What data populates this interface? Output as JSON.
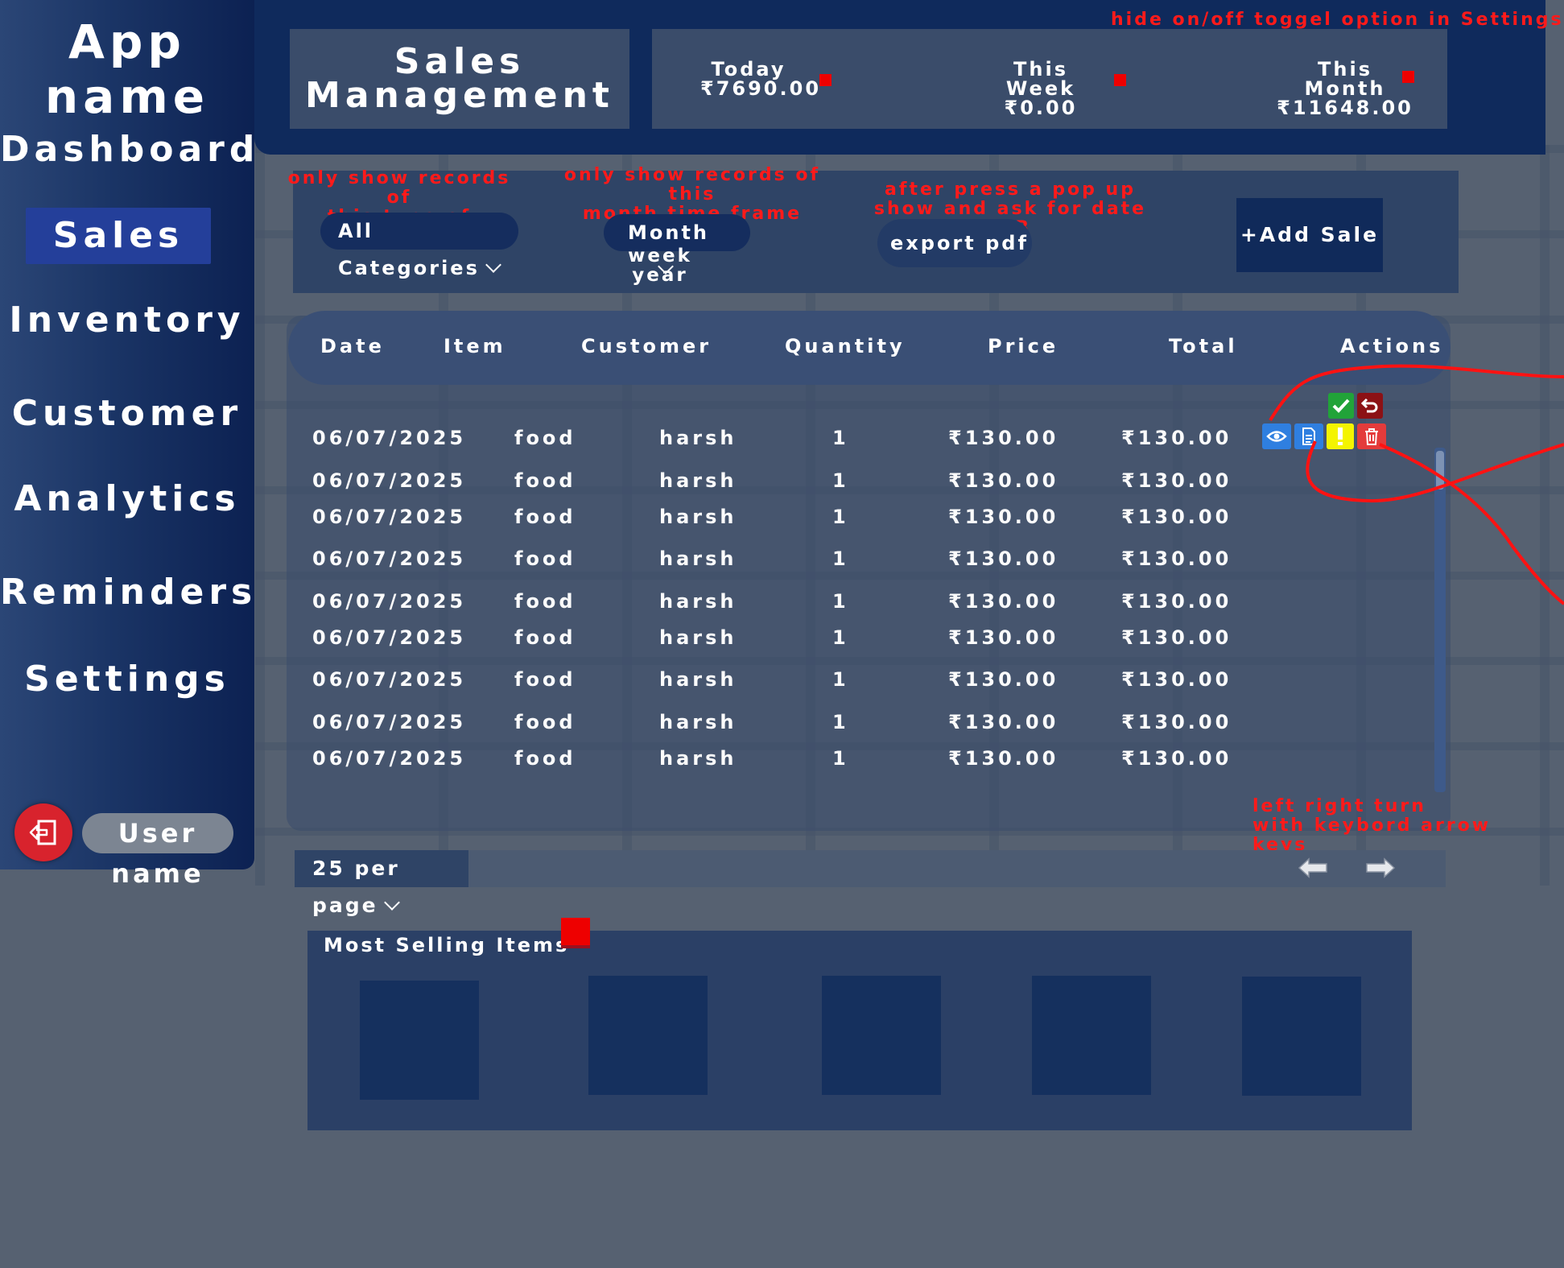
{
  "sidebar": {
    "app_name": "App name",
    "items": [
      {
        "label": "Dashboard"
      },
      {
        "label": "Sales",
        "active": true
      },
      {
        "label": "Inventory"
      },
      {
        "label": "Customer"
      },
      {
        "label": "Analytics"
      },
      {
        "label": "Reminders"
      },
      {
        "label": "Settings"
      }
    ],
    "user_name": "User name",
    "logout_icon": "logout-icon"
  },
  "header": {
    "title_line1": "Sales",
    "title_line2": "Management",
    "stats": [
      {
        "label": "Today",
        "value": "₹7690.00"
      },
      {
        "label": "This Week",
        "value": "₹0.00"
      },
      {
        "label": "This Month",
        "value": "₹11648.00"
      }
    ]
  },
  "annotations": {
    "hide_toggle": "hide on/off toggel option in Settings",
    "category_note_1": "only show records of",
    "category_note_2": "this type of categ.",
    "timeframe_note_1": "only show records of this",
    "timeframe_note_2": "month time frame",
    "export_note_1": "after press a pop up",
    "export_note_2": "show and ask for date A-B",
    "arrow_note_1": "left right  turn",
    "arrow_note_2": "with keybord arrow keys"
  },
  "filters": {
    "category": "All Categories",
    "timeframe_selected": "Month",
    "timeframe_options": [
      "week",
      "year"
    ],
    "export_label": "export pdf",
    "add_sale_label": "+Add Sale"
  },
  "table": {
    "columns": [
      "Date",
      "Item",
      "Customer",
      "Quantity",
      "Price",
      "Total",
      "Actions"
    ],
    "rows": [
      [
        "06/07/2025",
        "food",
        "harsh",
        "1",
        "₹130.00",
        "₹130.00"
      ],
      [
        "06/07/2025",
        "food",
        "harsh",
        "1",
        "₹130.00",
        "₹130.00"
      ],
      [
        "06/07/2025",
        "food",
        "harsh",
        "1",
        "₹130.00",
        "₹130.00"
      ],
      [
        "06/07/2025",
        "food",
        "harsh",
        "1",
        "₹130.00",
        "₹130.00"
      ],
      [
        "06/07/2025",
        "food",
        "harsh",
        "1",
        "₹130.00",
        "₹130.00"
      ],
      [
        "06/07/2025",
        "food",
        "harsh",
        "1",
        "₹130.00",
        "₹130.00"
      ],
      [
        "06/07/2025",
        "food",
        "harsh",
        "1",
        "₹130.00",
        "₹130.00"
      ],
      [
        "06/07/2025",
        "food",
        "harsh",
        "1",
        "₹130.00",
        "₹130.00"
      ],
      [
        "06/07/2025",
        "food",
        "harsh",
        "1",
        "₹130.00",
        "₹130.00"
      ]
    ],
    "action_icons": [
      "eye-icon",
      "document-icon",
      "alert-icon",
      "trash-icon",
      "check-icon",
      "undo-icon"
    ]
  },
  "pagination": {
    "per_page": "25 per page",
    "prev_icon": "arrow-left-icon",
    "next_icon": "arrow-right-icon"
  },
  "most_selling": {
    "title": "Most Selling Items",
    "tiles": 5
  },
  "colors": {
    "annotation": "#ff1a1a",
    "sidebar": "#1a3465",
    "header": "#0f2a5c",
    "active_nav": "#243f9a"
  }
}
